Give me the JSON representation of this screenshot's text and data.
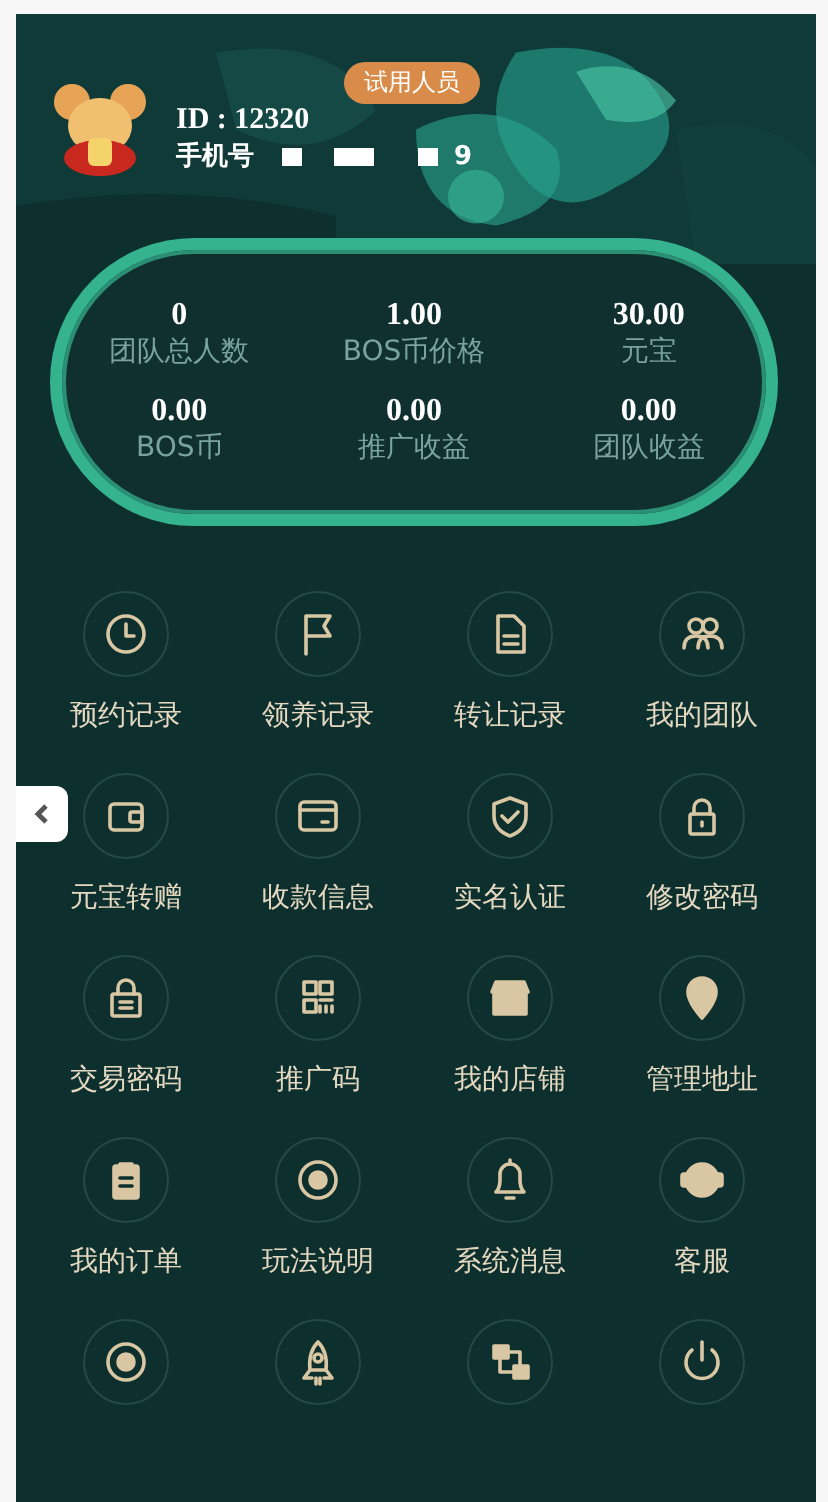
{
  "profile": {
    "badge": "试用人员",
    "id_text": "ID : 12320",
    "phone_label": "手机号",
    "phone_tail": "9"
  },
  "stats": [
    {
      "value": "0",
      "label": "团队总人数"
    },
    {
      "value": "1.00",
      "label": "BOS币价格"
    },
    {
      "value": "30.00",
      "label": "元宝"
    },
    {
      "value": "0.00",
      "label": "BOS币"
    },
    {
      "value": "0.00",
      "label": "推广收益"
    },
    {
      "value": "0.00",
      "label": "团队收益"
    }
  ],
  "menu": [
    {
      "kind": "labeled",
      "label": "预约记录"
    },
    {
      "kind": "labeled",
      "label": "领养记录"
    },
    {
      "kind": "labeled",
      "label": "转让记录"
    },
    {
      "kind": "labeled",
      "label": "我的团队"
    },
    {
      "kind": "labeled",
      "label": "元宝转赠"
    },
    {
      "kind": "labeled",
      "label": "收款信息"
    },
    {
      "kind": "labeled",
      "label": "实名认证"
    },
    {
      "kind": "labeled",
      "label": "修改密码"
    },
    {
      "kind": "labeled",
      "label": "交易密码"
    },
    {
      "kind": "labeled",
      "label": "推广码"
    },
    {
      "kind": "labeled",
      "label": "我的店铺"
    },
    {
      "kind": "labeled",
      "label": "管理地址"
    },
    {
      "kind": "labeled",
      "label": "我的订单"
    },
    {
      "kind": "labeled",
      "label": "玩法说明"
    },
    {
      "kind": "labeled",
      "label": "系统消息"
    },
    {
      "kind": "labeled",
      "label": "客服"
    },
    {
      "kind": "icon"
    },
    {
      "kind": "icon"
    },
    {
      "kind": "icon"
    },
    {
      "kind": "icon"
    }
  ]
}
